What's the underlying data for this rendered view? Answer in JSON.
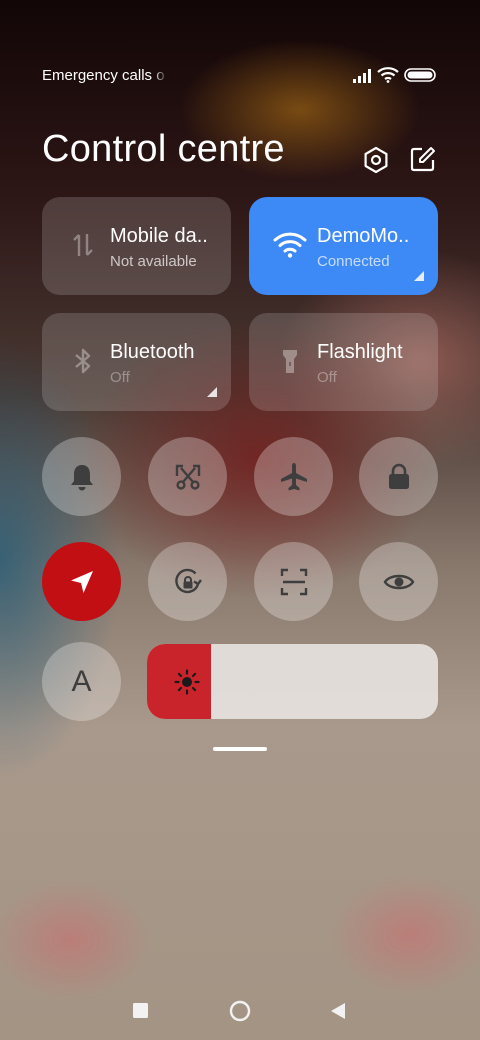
{
  "status_bar": {
    "carrier_text": "Emergency calls o",
    "icons": [
      "signal-icon",
      "wifi-icon",
      "battery-icon"
    ]
  },
  "header": {
    "title": "Control centre",
    "actions": [
      "settings-icon",
      "edit-icon"
    ]
  },
  "tiles": [
    {
      "id": "mobile-data",
      "icon": "mobile-data-icon",
      "label": "Mobile da..",
      "status": "Not available",
      "active": false
    },
    {
      "id": "wifi",
      "icon": "wifi-icon",
      "label": "DemoMo..",
      "status": "Connected",
      "active": true
    },
    {
      "id": "bluetooth",
      "icon": "bluetooth-icon",
      "label": "Bluetooth",
      "status": "Off",
      "active": false
    },
    {
      "id": "flashlight",
      "icon": "flashlight-icon",
      "label": "Flashlight",
      "status": "Off",
      "active": false
    }
  ],
  "toggles": [
    {
      "icon": "bell-icon",
      "on": false
    },
    {
      "icon": "screenshot-icon",
      "on": false
    },
    {
      "icon": "airplane-icon",
      "on": false
    },
    {
      "icon": "lock-icon",
      "on": false
    },
    {
      "icon": "location-icon",
      "on": true
    },
    {
      "icon": "rotation-lock-icon",
      "on": false
    },
    {
      "icon": "scanner-icon",
      "on": false
    },
    {
      "icon": "eye-icon",
      "on": false
    },
    {
      "icon": "auto-brightness-icon",
      "label": "A",
      "on": false
    }
  ],
  "brightness": {
    "level": 0.22,
    "icon": "sun-icon"
  },
  "colors": {
    "accent_blue": "#3d8af7",
    "accent_red": "#c20f14",
    "brightness_fill": "#c9232b"
  },
  "nav_bar": [
    "recents-icon",
    "home-icon",
    "back-icon"
  ]
}
